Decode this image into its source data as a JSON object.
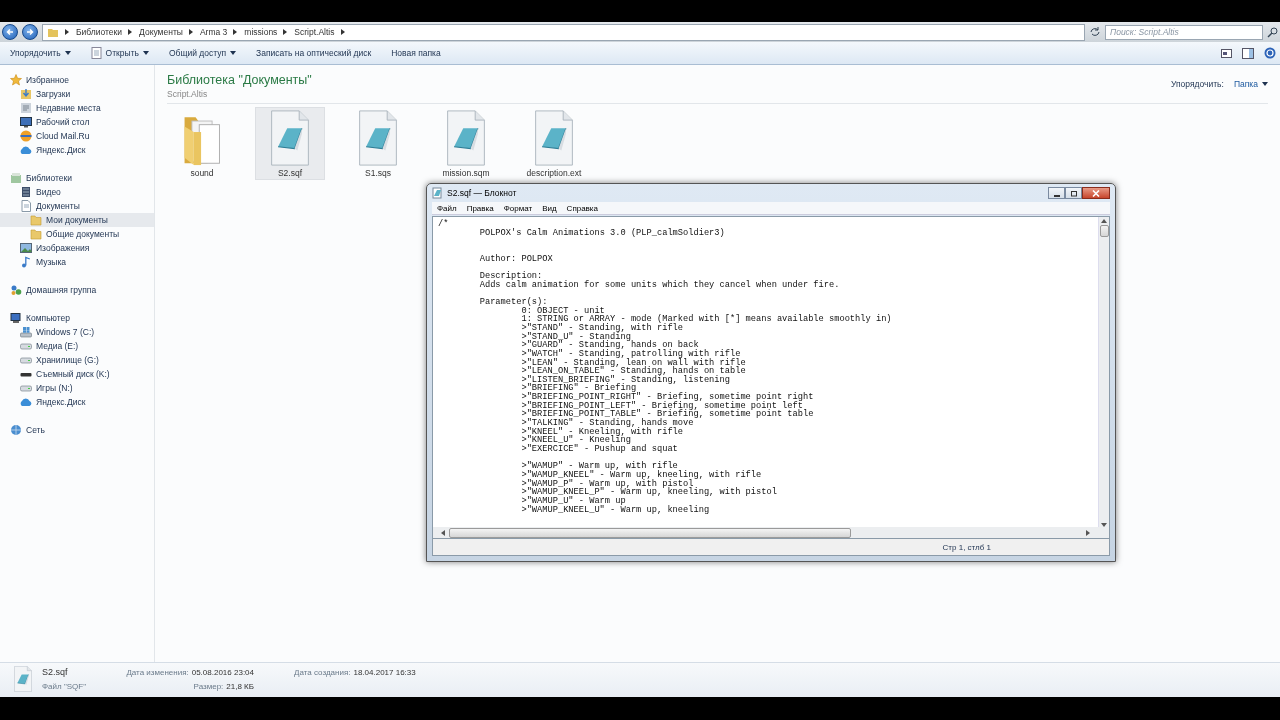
{
  "address_bar": {
    "crumbs": [
      "Библиотеки",
      "Документы",
      "Arma 3",
      "missions",
      "Script.Altis"
    ]
  },
  "search": {
    "placeholder": "Поиск: Script.Altis"
  },
  "toolbar": [
    {
      "label": "Упорядочить",
      "dropdown": true
    },
    {
      "label": "Открыть",
      "dropdown": true
    },
    {
      "label": "Общий доступ",
      "dropdown": true
    },
    {
      "label": "Записать на оптический диск",
      "dropdown": false
    },
    {
      "label": "Новая папка",
      "dropdown": false
    }
  ],
  "sidebar": {
    "items": [
      {
        "label": "Избранное",
        "kind": "star",
        "selected": false,
        "children": [
          {
            "label": "Загрузки",
            "kind": "download",
            "selected": false
          },
          {
            "label": "Недавние места",
            "kind": "recent",
            "selected": false
          },
          {
            "label": "Рабочий стол",
            "kind": "desktop",
            "selected": false
          },
          {
            "label": "Cloud Mail.Ru",
            "kind": "globe",
            "selected": false
          },
          {
            "label": "Яндекс.Диск",
            "kind": "cloud",
            "selected": false
          }
        ]
      },
      {
        "label": "Библиотеки",
        "kind": "library",
        "selected": false,
        "children": [
          {
            "label": "Видео",
            "kind": "video",
            "selected": false
          },
          {
            "label": "Документы",
            "kind": "document",
            "selected": false,
            "children": [
              {
                "label": "Мои документы",
                "kind": "folder",
                "selected": true
              },
              {
                "label": "Общие документы",
                "kind": "folder",
                "selected": false
              }
            ]
          },
          {
            "label": "Изображения",
            "kind": "picture",
            "selected": false
          },
          {
            "label": "Музыка",
            "kind": "music",
            "selected": false
          }
        ]
      },
      {
        "label": "Домашняя группа",
        "kind": "homegroup",
        "selected": false
      },
      {
        "label": "Компьютер",
        "kind": "computer",
        "selected": false,
        "children": [
          {
            "label": "Windows 7 (C:)",
            "kind": "system",
            "selected": false
          },
          {
            "label": "Медиа (E:)",
            "kind": "drive",
            "selected": false
          },
          {
            "label": "Хранилище (G:)",
            "kind": "drive",
            "selected": false
          },
          {
            "label": "Съемный диск (K:)",
            "kind": "removable",
            "selected": false
          },
          {
            "label": "Игры (N:)",
            "kind": "drive",
            "selected": false
          },
          {
            "label": "Яндекс.Диск",
            "kind": "cloud",
            "selected": false
          }
        ]
      },
      {
        "label": "Сеть",
        "kind": "network",
        "selected": false
      }
    ]
  },
  "library": {
    "title": "Библиотека \"Документы\"",
    "subtitle": "Script.Altis",
    "arrange_label": "Упорядочить:",
    "arrange_value": "Папка"
  },
  "files": [
    {
      "name": "sound",
      "kind": "folder",
      "selected": false
    },
    {
      "name": "S2.sqf",
      "kind": "document",
      "selected": true
    },
    {
      "name": "S1.sqs",
      "kind": "document",
      "selected": false
    },
    {
      "name": "mission.sqm",
      "kind": "document",
      "selected": false
    },
    {
      "name": "description.ext",
      "kind": "document",
      "selected": false
    }
  ],
  "notepad": {
    "title": "S2.sqf — Блокнот",
    "menu": [
      "Файл",
      "Правка",
      "Формат",
      "Вид",
      "Справка"
    ],
    "text": "/*\n\tPOLPOX's Calm Animations 3.0 (PLP_calmSoldier3)\n\n\n\tAuthor: POLPOX\n\n\tDescription:\n\tAdds calm animation for some units which they cancel when under fire.\n\n\tParameter(s):\n\t\t0: OBJECT - unit\n\t\t1: STRING or ARRAY - mode (Marked with [*] means available smoothly in)\n\t\t>\"STAND\" - Standing, with rifle\n\t\t>\"STAND_U\" - Standing\n\t\t>\"GUARD\" - Standing, hands on back\n\t\t>\"WATCH\" - Standing, patrolling with rifle\n\t\t>\"LEAN\" - Standing, lean on wall with rifle\n\t\t>\"LEAN_ON_TABLE\" - Standing, hands on table\n\t\t>\"LISTEN_BRIEFING\" - Standing, listening\n\t\t>\"BRIEFING\" - Briefing\n\t\t>\"BRIEFING_POINT_RIGHT\" - Briefing, sometime point right\n\t\t>\"BRIEFING_POINT_LEFT\" - Briefing, sometime point left\n\t\t>\"BRIEFING_POINT_TABLE\" - Briefing, sometime point table\n\t\t>\"TALKING\" - Standing, hands move\n\t\t>\"KNEEL\" - Kneeling, with rifle\n\t\t>\"KNEEL_U\" - Kneeling\n\t\t>\"EXERCICE\" - Pushup and squat\n\n\t\t>\"WAMUP\" - Warm up, with rifle\n\t\t>\"WAMUP_KNEEL\" - Warm up, kneeling, with rifle\n\t\t>\"WAMUP_P\" - Warm up, with pistol\n\t\t>\"WAMUP_KNEEL_P\" - Warm up, kneeling, with pistol\n\t\t>\"WAMUP_U\" - Warm up\n\t\t>\"WAMUP_KNEEL_U\" - Warm up, kneeling",
    "status": "Стр 1, стлб 1"
  },
  "details": {
    "name": "S2.sqf",
    "type": "Файл \"SQF\"",
    "fields": [
      {
        "label": "Дата изменения:",
        "value": "05.08.2016 23:04"
      },
      {
        "label": "Размер:",
        "value": "21,8 КБ"
      },
      {
        "label": "Дата создания:",
        "value": "18.04.2017 16:33"
      }
    ]
  }
}
